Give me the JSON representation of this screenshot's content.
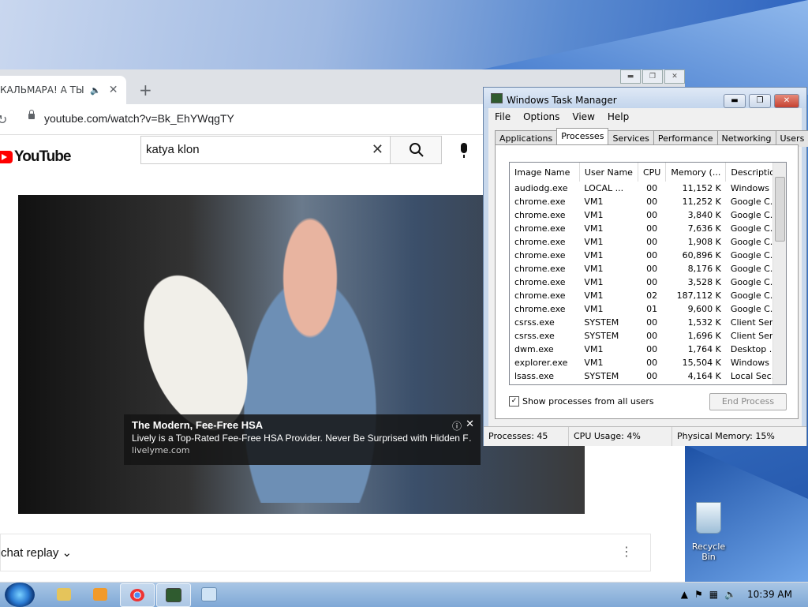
{
  "browser": {
    "tab_title": "КАЛЬМАРА! А ТЫ ХО",
    "tab_audio_icon": "speaker-icon",
    "new_tab": "+",
    "url": "youtube.com/watch?v=Bk_EhYWqgTY",
    "youtube_logo": "YouTube",
    "search_query": "katya klon",
    "ad": {
      "title": "The Modern, Fee-Free HSA",
      "description": "Lively is a Top-Rated Fee-Free HSA Provider. Never Be Surprised with Hidden F…",
      "url": "livelyme.com"
    },
    "chat_label": "chat replay"
  },
  "task_manager": {
    "title": "Windows Task Manager",
    "menus": [
      "File",
      "Options",
      "View",
      "Help"
    ],
    "tabs": [
      "Applications",
      "Processes",
      "Services",
      "Performance",
      "Networking",
      "Users"
    ],
    "active_tab": "Processes",
    "columns": [
      "Image Name",
      "User Name",
      "CPU",
      "Memory (...",
      "Description"
    ],
    "rows": [
      [
        "audiodg.exe",
        "LOCAL ...",
        "00",
        "11,152 K",
        "Windows ..."
      ],
      [
        "chrome.exe",
        "VM1",
        "00",
        "11,252 K",
        "Google C..."
      ],
      [
        "chrome.exe",
        "VM1",
        "00",
        "3,840 K",
        "Google C..."
      ],
      [
        "chrome.exe",
        "VM1",
        "00",
        "7,636 K",
        "Google C..."
      ],
      [
        "chrome.exe",
        "VM1",
        "00",
        "1,908 K",
        "Google C..."
      ],
      [
        "chrome.exe",
        "VM1",
        "00",
        "60,896 K",
        "Google C..."
      ],
      [
        "chrome.exe",
        "VM1",
        "00",
        "8,176 K",
        "Google C..."
      ],
      [
        "chrome.exe",
        "VM1",
        "00",
        "3,528 K",
        "Google C..."
      ],
      [
        "chrome.exe",
        "VM1",
        "02",
        "187,112 K",
        "Google C..."
      ],
      [
        "chrome.exe",
        "VM1",
        "01",
        "9,600 K",
        "Google C..."
      ],
      [
        "csrss.exe",
        "SYSTEM",
        "00",
        "1,532 K",
        "Client Ser..."
      ],
      [
        "csrss.exe",
        "SYSTEM",
        "00",
        "1,696 K",
        "Client Ser..."
      ],
      [
        "dwm.exe",
        "VM1",
        "00",
        "1,764 K",
        "Desktop ..."
      ],
      [
        "explorer.exe",
        "VM1",
        "00",
        "15,504 K",
        "Windows ..."
      ],
      [
        "lsass.exe",
        "SYSTEM",
        "00",
        "4,164 K",
        "Local Sec..."
      ]
    ],
    "show_all_label": "Show processes from all users",
    "show_all_checked": true,
    "end_process": "End Process",
    "status": {
      "processes": "Processes: 45",
      "cpu": "CPU Usage: 4%",
      "memory": "Physical Memory: 15%"
    }
  },
  "desktop": {
    "recycle_bin": "Recycle Bin"
  },
  "taskbar": {
    "clock": "10:39 AM",
    "items": [
      "windows-explorer-icon",
      "media-player-icon",
      "chrome-icon",
      "task-manager-icon",
      "notepad-icon"
    ]
  }
}
